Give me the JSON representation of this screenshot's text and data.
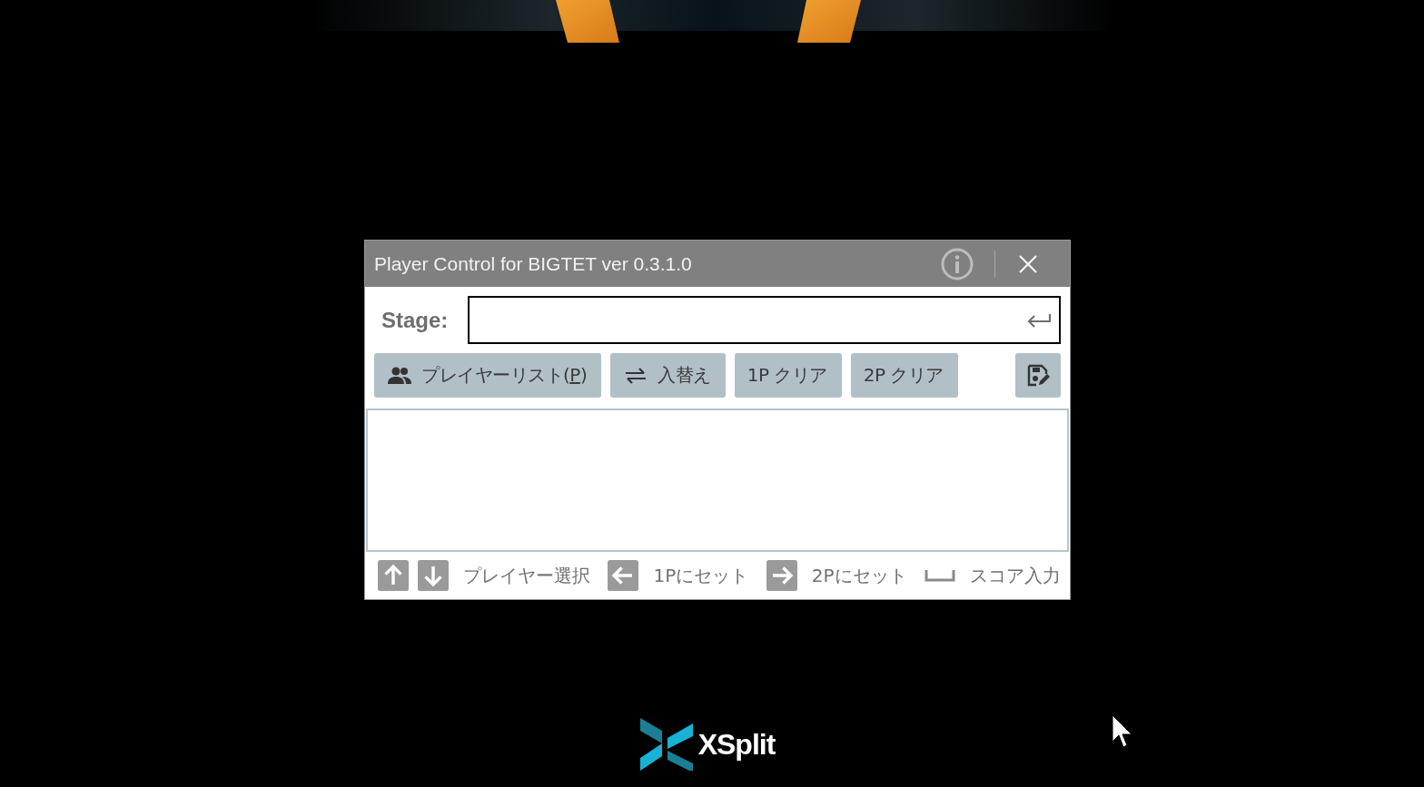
{
  "window": {
    "title": "Player Control for BIGTET ver 0.3.1.0"
  },
  "stage": {
    "label": "Stage:"
  },
  "buttons": [
    {
      "label": "プレイヤーリスト(",
      "access_key": "P",
      "label_end": ")"
    },
    {
      "label": "入替え"
    },
    {
      "label": "1P クリア"
    },
    {
      "label": "2P クリア"
    }
  ],
  "hints": [
    {
      "label": "プレイヤー選択"
    },
    {
      "label": "1Pにセット"
    },
    {
      "label": "2Pにセット"
    },
    {
      "label": "スコア入力"
    }
  ],
  "logo": {
    "text": "XSplit"
  }
}
